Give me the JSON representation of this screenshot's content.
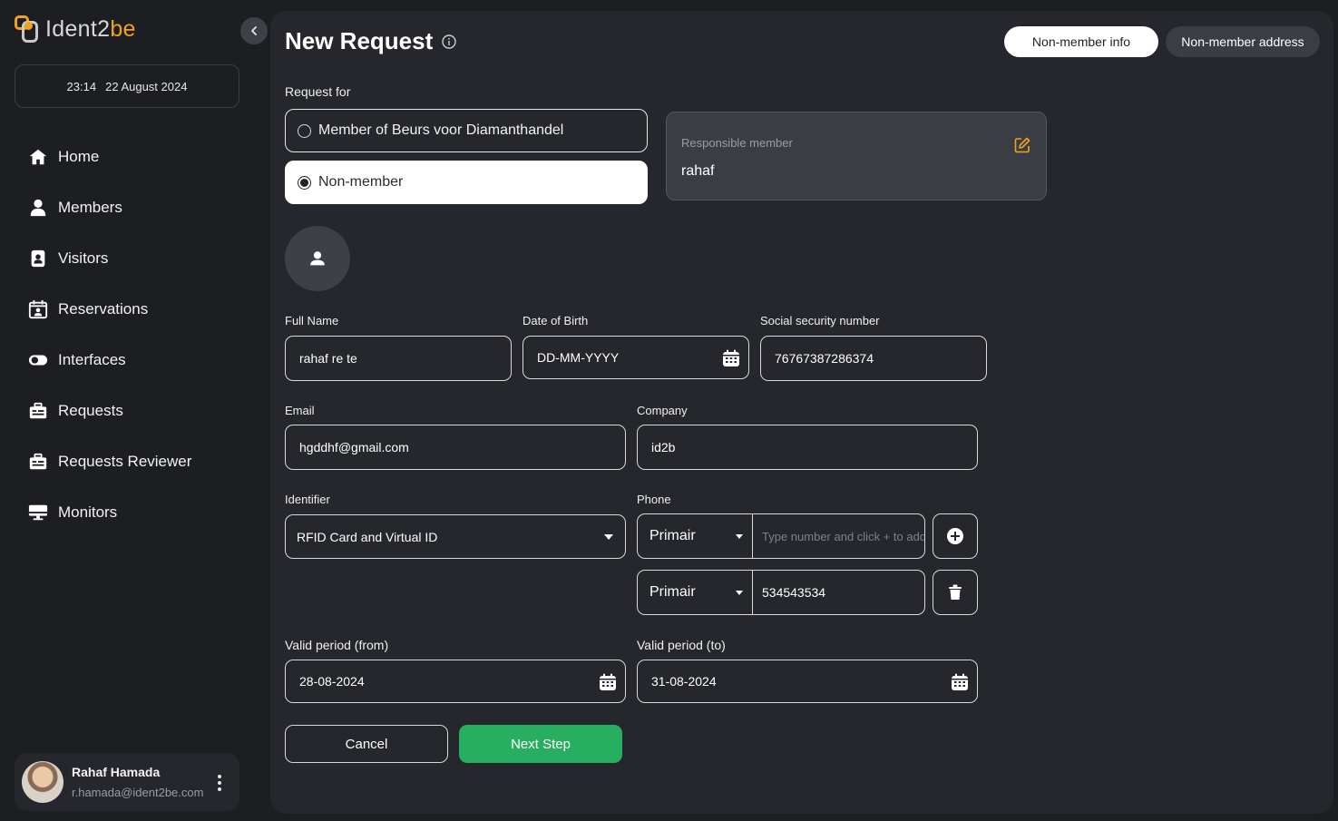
{
  "brand": {
    "name_part1": "Ident2",
    "name_part2": "be",
    "accent": "#f0a21b"
  },
  "datetime": {
    "time": "23:14",
    "date": "22 August 2024"
  },
  "sidebar": {
    "items": [
      {
        "label": "Home",
        "icon": "home-icon"
      },
      {
        "label": "Members",
        "icon": "person-icon"
      },
      {
        "label": "Visitors",
        "icon": "badge-icon"
      },
      {
        "label": "Reservations",
        "icon": "calendar-person-icon"
      },
      {
        "label": "Interfaces",
        "icon": "toggle-icon"
      },
      {
        "label": "Requests",
        "icon": "briefcase-icon"
      },
      {
        "label": "Requests Reviewer",
        "icon": "briefcase-icon"
      },
      {
        "label": "Monitors",
        "icon": "monitor-icon"
      }
    ]
  },
  "user": {
    "name": "Rahaf Hamada",
    "email": "r.hamada@ident2be.com"
  },
  "header": {
    "title": "New Request",
    "tabs": [
      {
        "label": "Non-member info",
        "active": true
      },
      {
        "label": "Non-member address",
        "active": false
      }
    ]
  },
  "form": {
    "request_for_label": "Request for",
    "options": [
      {
        "label": "Member of Beurs voor Diamanthandel",
        "selected": false
      },
      {
        "label": "Non-member",
        "selected": true
      }
    ],
    "responsible": {
      "label": "Responsible member",
      "value": "rahaf"
    },
    "full_name": {
      "label": "Full Name",
      "value": "rahaf re te"
    },
    "dob": {
      "label": "Date of Birth",
      "value": "DD-MM-YYYY"
    },
    "ssn": {
      "label": "Social security number",
      "value": "76767387286374"
    },
    "email": {
      "label": "Email",
      "value": "hgddhf@gmail.com"
    },
    "company": {
      "label": "Company",
      "value": "id2b"
    },
    "identifier": {
      "label": "Identifier",
      "value": "RFID Card and Virtual ID"
    },
    "phone": {
      "label": "Phone",
      "rows": [
        {
          "type": "Primair",
          "number": "",
          "placeholder": "Type number and click + to add"
        },
        {
          "type": "Primair",
          "number": "534543534",
          "placeholder": ""
        }
      ]
    },
    "valid_from": {
      "label": "Valid period (from)",
      "value": "28-08-2024"
    },
    "valid_to": {
      "label": "Valid period (to)",
      "value": "31-08-2024"
    },
    "cancel_label": "Cancel",
    "next_label": "Next Step",
    "next_color": "#27ae60"
  }
}
